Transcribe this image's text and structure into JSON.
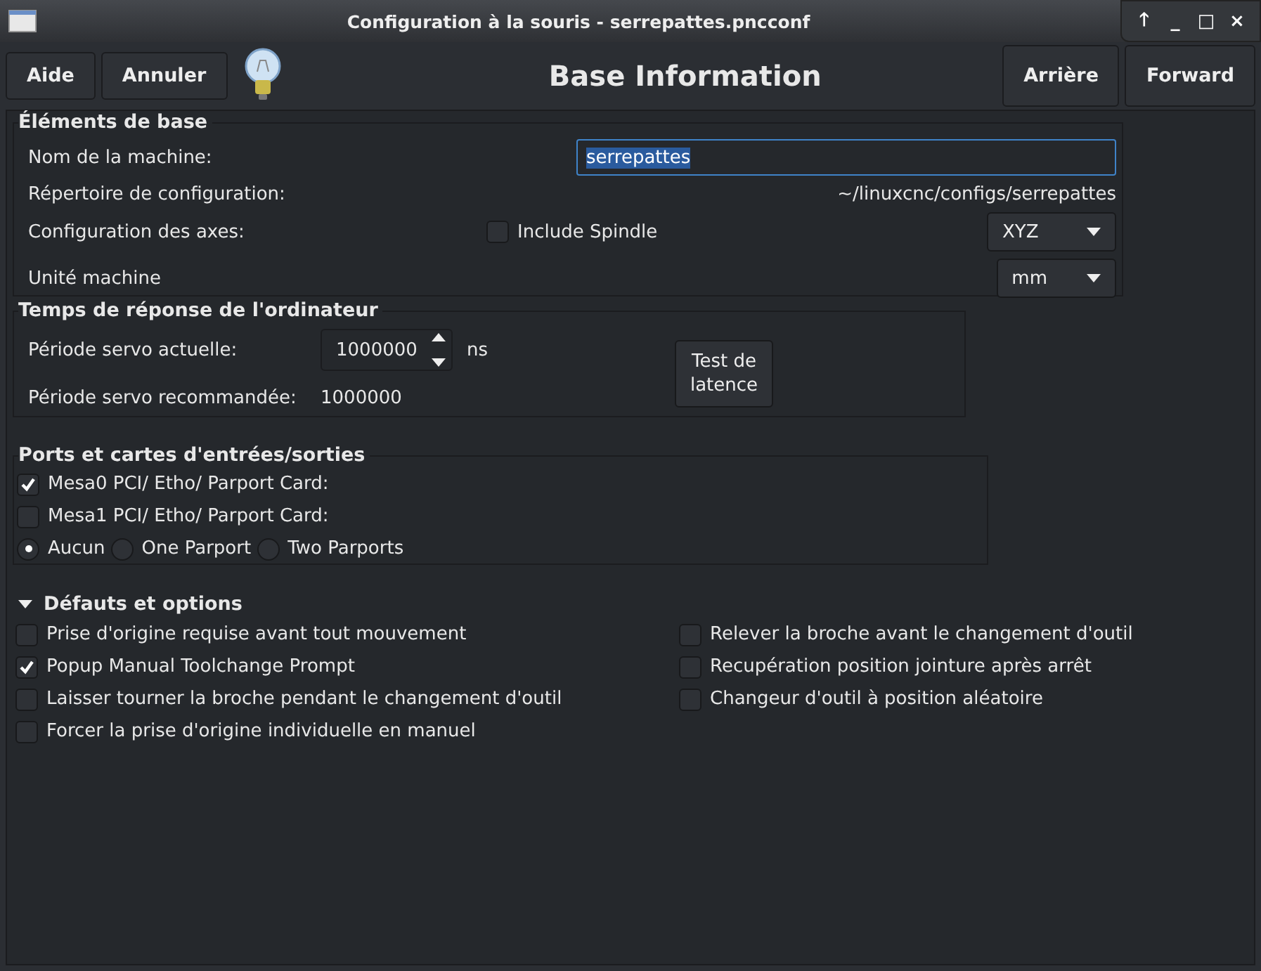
{
  "window": {
    "title": "Configuration à la souris - serrepattes.pncconf",
    "controls": [
      "🡑",
      "_",
      "□",
      "×"
    ]
  },
  "toolbar": {
    "left_buttons": [
      "Aide",
      "Annuler"
    ],
    "page_title": "Base Information",
    "right_buttons": [
      "Arrière",
      "Forward"
    ]
  },
  "base": {
    "title": "Éléments de base",
    "machine_name_label": "Nom de la machine:",
    "machine_name": "serrepattes",
    "config_dir_label": "Répertoire de configuration:",
    "config_dir": "~/linuxcnc/configs/serrepattes",
    "axes_label": "Configuration des axes:",
    "include_spindle": {
      "label": "Include Spindle",
      "checked": false
    },
    "axes_value": "XYZ",
    "units_label": "Unité machine",
    "units_value": "mm"
  },
  "timing": {
    "title": "Temps de réponse de l'ordinateur",
    "servo_label": "Période servo actuelle:",
    "servo_value": "1000000",
    "servo_unit": "ns",
    "recommended_label": "Période servo recommandée:",
    "recommended_value": "1000000",
    "latency_button": "Test de latence"
  },
  "ports": {
    "title": "Ports et cartes d'entrées/sorties",
    "cards": [
      {
        "label": "Mesa0 PCI/ Etho/ Parport Card:",
        "checked": true
      },
      {
        "label": "Mesa1 PCI/ Etho/ Parport Card:",
        "checked": false
      }
    ],
    "parport": [
      {
        "label": "Aucun",
        "selected": true
      },
      {
        "label": "One Parport",
        "selected": false
      },
      {
        "label": "Two Parports",
        "selected": false
      }
    ]
  },
  "defaults": {
    "title": "Défauts et options",
    "expanded": true,
    "left": [
      {
        "label": "Prise d'origine requise avant tout mouvement",
        "checked": false
      },
      {
        "label": "Popup Manual Toolchange Prompt",
        "checked": true
      },
      {
        "label": "Laisser tourner la broche pendant le changement d'outil",
        "checked": false
      },
      {
        "label": "Forcer la prise d'origine individuelle en manuel",
        "checked": false
      }
    ],
    "right": [
      {
        "label": "Relever la broche avant le changement d'outil",
        "checked": false
      },
      {
        "label": "Recupération position jointure après arrêt",
        "checked": false
      },
      {
        "label": "Changeur d'outil à position aléatoire",
        "checked": false
      }
    ]
  }
}
